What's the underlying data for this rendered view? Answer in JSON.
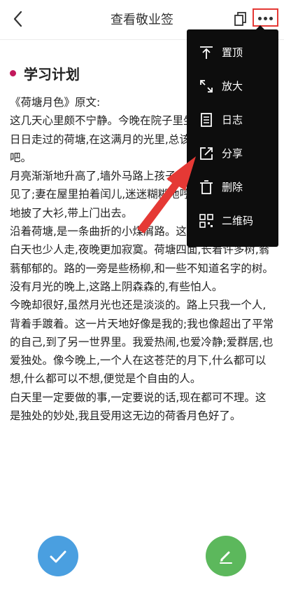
{
  "header": {
    "title": "查看敬业签"
  },
  "note": {
    "title": "学习计划",
    "paragraphs": [
      "《荷塘月色》原文:",
      "这几天心里颇不宁静。今晚在院子里坐着乘凉,忽然想起日日走过的荷塘,在这满月的光里,总该另有一番样子吧。",
      "月亮渐渐地升高了,墙外马路上孩子们的欢笑,已经听不见了;妻在屋里拍着闰儿,迷迷糊糊地哼着眠歌。我悄悄地披了大衫,带上门出去。",
      "沿着荷塘,是一条曲折的小煤屑路。这是一条幽僻的路;白天也少人走,夜晚更加寂寞。荷塘四面,长着许多树,蓊蓊郁郁的。路的一旁是些杨柳,和一些不知道名字的树。没有月光的晚上,这路上阴森森的,有些怕人。",
      "今晚却很好,虽然月光也还是淡淡的。路上只我一个人,背着手踱着。这一片天地好像是我的;我也像超出了平常的自己,到了另一世界里。我爱热闹,也爱冷静;爱群居,也爱独处。像今晚上,一个人在这苍茫的月下,什么都可以想,什么都可以不想,便觉是个自由的人。",
      "白天里一定要做的事,一定要说的话,现在都可不理。这是独处的妙处,我且受用这无边的荷香月色好了。"
    ]
  },
  "menu": {
    "items": [
      {
        "label": "置顶",
        "icon": "pin-top-icon"
      },
      {
        "label": "放大",
        "icon": "expand-icon"
      },
      {
        "label": "日志",
        "icon": "log-icon"
      },
      {
        "label": "分享",
        "icon": "share-icon"
      },
      {
        "label": "删除",
        "icon": "trash-icon"
      },
      {
        "label": "二维码",
        "icon": "qr-code-icon"
      }
    ]
  },
  "colors": {
    "highlight_border": "#e53935",
    "title_dot": "#c2185b",
    "fab_check": "#4a9fe0",
    "fab_edit": "#5cb85c",
    "menu_bg": "#0d0d0d",
    "arrow": "#e53935"
  }
}
